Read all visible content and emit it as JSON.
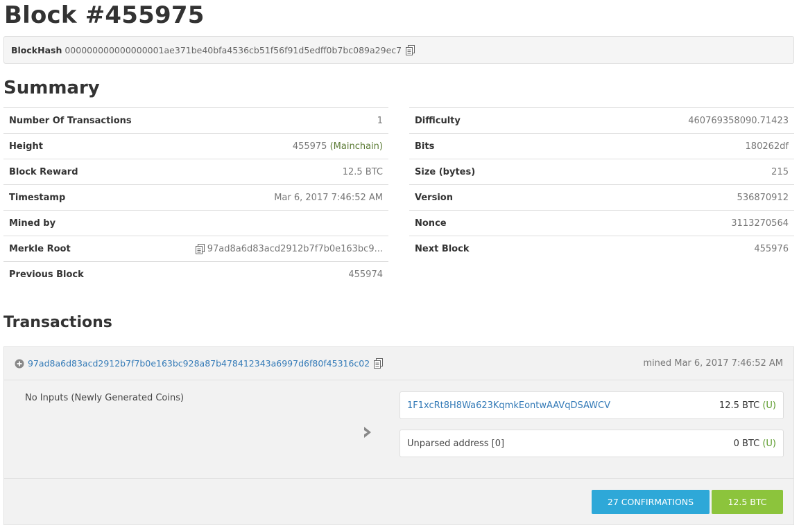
{
  "page": {
    "title": "Block #455975"
  },
  "blockhash": {
    "label": "BlockHash",
    "value": "000000000000000001ae371be40bfa4536cb51f56f91d5edff0b7bc089a29ec7"
  },
  "summary": {
    "heading": "Summary",
    "left": [
      {
        "key": "Number Of Transactions",
        "value": "1"
      },
      {
        "key": "Height",
        "value": "455975",
        "extra": "(Mainchain)"
      },
      {
        "key": "Block Reward",
        "value": "12.5 BTC"
      },
      {
        "key": "Timestamp",
        "value": "Mar 6, 2017 7:46:52 AM"
      },
      {
        "key": "Mined by",
        "value": ""
      },
      {
        "key": "Merkle Root",
        "value": "97ad8a6d83acd2912b7f7b0e163bc9..."
      },
      {
        "key": "Previous Block",
        "value": "455974"
      }
    ],
    "right": [
      {
        "key": "Difficulty",
        "value": "460769358090.71423"
      },
      {
        "key": "Bits",
        "value": "180262df"
      },
      {
        "key": "Size (bytes)",
        "value": "215"
      },
      {
        "key": "Version",
        "value": "536870912"
      },
      {
        "key": "Nonce",
        "value": "3113270564"
      },
      {
        "key": "Next Block",
        "value": "455976"
      }
    ]
  },
  "transactions": {
    "heading": "Transactions",
    "tx": {
      "txid": "97ad8a6d83acd2912b7f7b0e163bc928a87b478412343a6997d6f80f45316c02",
      "mined": "mined Mar 6, 2017 7:46:52 AM",
      "inputs_text": "No Inputs (Newly Generated Coins)",
      "outputs": [
        {
          "address": "1F1xcRt8H8Wa623KqmkEontwAAVqDSAWCV",
          "amount": "12.5 BTC",
          "flag": "(U)"
        },
        {
          "address": "Unparsed address [0]",
          "amount": "0 BTC",
          "flag": "(U)"
        }
      ],
      "confirmations": "27 CONFIRMATIONS",
      "total": "12.5 BTC"
    }
  },
  "colors": {
    "link": "#337ab7",
    "confirmations_bg": "#2ea8d8",
    "amount_bg": "#8cc43c"
  },
  "icons": [
    "copy-icon",
    "plus-circle-icon",
    "chevron-right-icon"
  ]
}
